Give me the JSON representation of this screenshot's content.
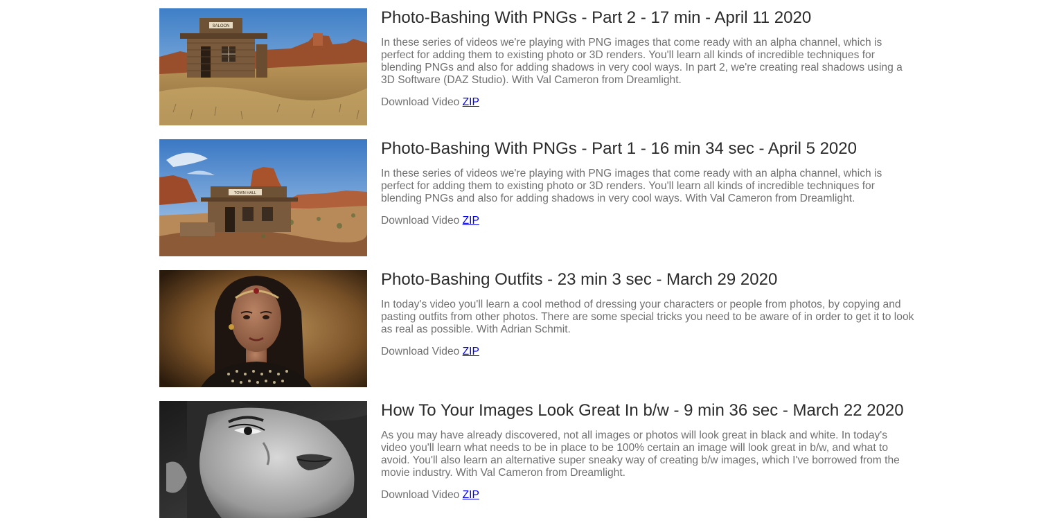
{
  "videos": [
    {
      "title": "Photo-Bashing With PNGs - Part 2 - 17 min - April 11 2020",
      "description": "In these series of videos we're playing with PNG images that come ready with an alpha channel, which is perfect for adding them to existing photo or 3D renders. You'll learn all kinds of incredible techniques for blending PNGs and also for adding shadows in very cool ways. In part 2, we're creating real shadows using a 3D Software (DAZ Studio). With Val Cameron from Dreamlight.",
      "download_label": "Download Video",
      "link_label": "ZIP",
      "thumb_sign": "SALOON"
    },
    {
      "title": "Photo-Bashing With PNGs - Part 1 - 16 min 34 sec - April 5 2020",
      "description": "In these series of videos we're playing with PNG images that come ready with an alpha channel, which is perfect for adding them to existing photo or 3D renders. You'll learn all kinds of incredible techniques for blending PNGs and also for adding shadows in very cool ways. With Val Cameron from Dreamlight.",
      "download_label": "Download Video",
      "link_label": "ZIP",
      "thumb_sign": "TOWN HALL"
    },
    {
      "title": "Photo-Bashing Outfits - 23 min 3 sec - March 29 2020",
      "description": "In today's video you'll learn a cool method of dressing your characters or people from photos, by copying and pasting outfits from other photos. There are some special tricks you need to be aware of in order to get it to look as real as possible. With Adrian Schmit.",
      "download_label": "Download Video",
      "link_label": "ZIP"
    },
    {
      "title": "How To Your Images Look Great In b/w - 9 min 36 sec - March 22 2020",
      "description": "As you may have already discovered, not all images or photos will look great in black and white. In today's video you'll learn what needs to be in place to be 100% certain an image will look great in b/w, and what to avoid. You'll also learn an alternative super sneaky way of creating b/w images, which I've borrowed from the movie industry. With Val Cameron from Dreamlight.",
      "download_label": "Download Video",
      "link_label": "ZIP"
    }
  ]
}
